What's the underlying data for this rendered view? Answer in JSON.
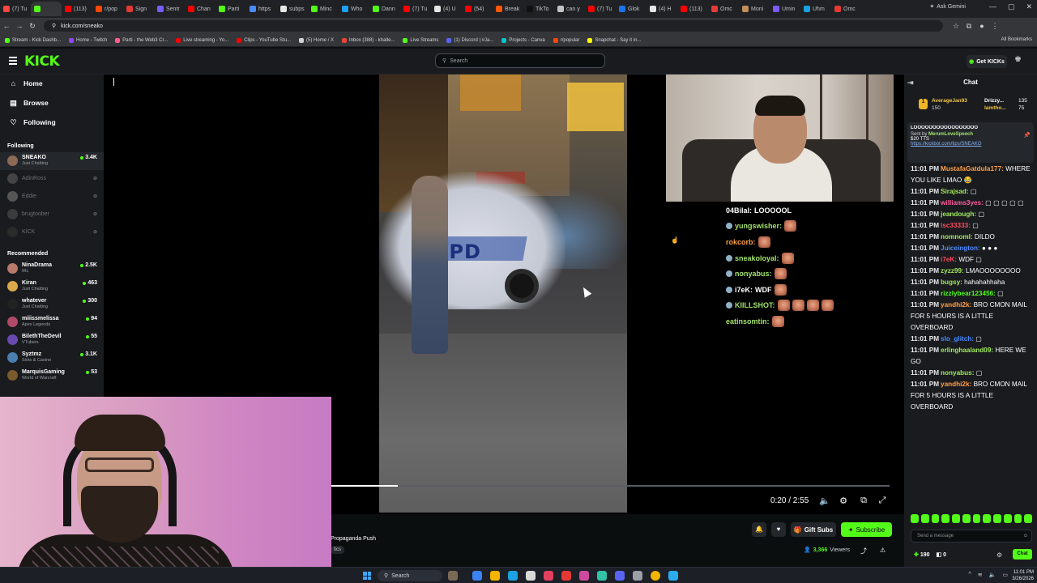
{
  "browser": {
    "tabs": [
      "(7) Tu",
      "",
      "(113)",
      "r/pop",
      "Sign",
      "Sentr",
      "Chan",
      "Parti",
      "https",
      "subps",
      "Minc",
      "Who",
      "Dann",
      "(7) Tu",
      "(4) U",
      "(54)",
      "Break",
      "TikTo",
      "can y",
      "(7) Tu",
      "Glok",
      "(4) H",
      "(113)",
      "Omc",
      "Moni",
      "Umin",
      "Uhm",
      "Omc"
    ],
    "active_tab_index": 1,
    "ask_gemini": "Ask Gemini",
    "url": "kick.com/sneako",
    "bookmarks": [
      "Stream - Kick Dashb...",
      "Home - Twitch",
      "Parti - the Web3 Cr...",
      "Live streaming - Yo...",
      "Clips - YouTube Stu...",
      "(5) Home / X",
      "Inbox (388) - khalle...",
      "Live Streams",
      "(1) Discord | #Ja...",
      "Projects - Canva",
      "r/popular",
      "Snapchat - Say it in..."
    ],
    "all_bookmarks": "All Bookmarks"
  },
  "header": {
    "logo": "KICK",
    "search_placeholder": "Search",
    "get_kicks": "Get KICKs"
  },
  "sidebar": {
    "nav": [
      {
        "label": "Home"
      },
      {
        "label": "Browse"
      },
      {
        "label": "Following"
      }
    ],
    "following_title": "Following",
    "following": [
      {
        "name": "SNEAKO",
        "category": "Just Chatting",
        "viewers": "3.4K",
        "live": true,
        "color": "#8c6a55"
      },
      {
        "name": "AdinRoss",
        "category": "",
        "viewers": "",
        "live": false,
        "color": "#444"
      },
      {
        "name": "Eddie",
        "category": "",
        "viewers": "",
        "live": false,
        "color": "#555"
      },
      {
        "name": "brugtoober",
        "category": "",
        "viewers": "",
        "live": false,
        "color": "#3b3b3b"
      },
      {
        "name": "KICK",
        "category": "",
        "viewers": "",
        "live": false,
        "color": "#2a2a2a"
      }
    ],
    "recommended_title": "Recommended",
    "recommended": [
      {
        "name": "NinaDrama",
        "category": "IRL",
        "viewers": "2.5K",
        "color": "#b87a6a"
      },
      {
        "name": "Kiran",
        "category": "Just Chatting",
        "viewers": "463",
        "color": "#d8a84a"
      },
      {
        "name": "whatever",
        "category": "Just Chatting",
        "viewers": "300",
        "color": "#222"
      },
      {
        "name": "miiissmelissa",
        "category": "Apex Legends",
        "viewers": "94",
        "color": "#b04a6a"
      },
      {
        "name": "BilethTheDevil",
        "category": "VTubers",
        "viewers": "55",
        "color": "#6a4ab0"
      },
      {
        "name": "Syztmz",
        "category": "Slots & Casino",
        "viewers": "3.1K",
        "color": "#4a80b0"
      },
      {
        "name": "MarquisGaming",
        "category": "World of Warcraft",
        "viewers": "53",
        "color": "#7a5a2a"
      }
    ]
  },
  "player": {
    "car_text": "YPD",
    "time": "0:20 / 2:55",
    "progress_fraction": 0.12
  },
  "overlay_chat": [
    {
      "user": "04Bilal:",
      "msg": "LOOOOOL",
      "user_color": "#ffffff",
      "emotes": 0,
      "badge": false
    },
    {
      "user": "yungswisher:",
      "msg": "",
      "user_color": "#a2e06b",
      "emotes": 1,
      "badge": true
    },
    {
      "user": "rokcorb:",
      "msg": "",
      "user_color": "#ff9f45",
      "emotes": 1,
      "badge": false
    },
    {
      "user": "sneakoloyal:",
      "msg": "",
      "user_color": "#a2e06b",
      "emotes": 1,
      "badge": true
    },
    {
      "user": "nonyabus:",
      "msg": "",
      "user_color": "#a2e06b",
      "emotes": 1,
      "badge": true
    },
    {
      "user": "i7eK:",
      "msg": "WDF",
      "user_color": "#ffffff",
      "emotes": 1,
      "badge": true
    },
    {
      "user": "KIILLSHOT:",
      "msg": "",
      "user_color": "#a2e06b",
      "emotes": 4,
      "badge": true
    },
    {
      "user": "eatinsomtin:",
      "msg": "",
      "user_color": "#a2e06b",
      "emotes": 1,
      "badge": false
    }
  ],
  "stream_info": {
    "title": "Propaganda Push",
    "tag": "tics",
    "gift_subs": "Gift Subs",
    "subscribe": "Subscribe",
    "viewer_count": "3,366",
    "viewers_label": "Viewers"
  },
  "chat": {
    "title": "Chat",
    "leaderboard": [
      {
        "name": "AverageJan93",
        "amount": "150"
      },
      {
        "name": "Drizzy...",
        "amount": "135"
      },
      {
        "name": "lamtho...",
        "amount": "75"
      }
    ],
    "pinned_top": "LOOOOOOOOOOOOOOOOO",
    "pinned_sender": "Sent by",
    "pinned_sender_name": "MerumLoveSpeech",
    "pinned_amount": "$20 TTS",
    "pinned_link": "https://kickbot.com/tips/SNEAKO",
    "messages": [
      {
        "time": "11:01 PM",
        "user": "MustafaGatdula177:",
        "color": "c-orange",
        "text": "WHERE YOU LIKE LMAO 😂"
      },
      {
        "time": "11:01 PM",
        "user": "Sirajsad:",
        "color": "c-lime",
        "text": "▢"
      },
      {
        "time": "11:01 PM",
        "user": "williams3yes:",
        "color": "c-pink",
        "text": "▢ ▢ ▢ ▢ ▢"
      },
      {
        "time": "11:01 PM",
        "user": "jeandough:",
        "color": "c-lime",
        "text": "▢"
      },
      {
        "time": "11:01 PM",
        "user": "lsc33333:",
        "color": "c-red",
        "text": "▢"
      },
      {
        "time": "11:01 PM",
        "user": "nomnoml:",
        "color": "c-lime",
        "text": "DILDO"
      },
      {
        "time": "11:01 PM",
        "user": "Juiceington:",
        "color": "c-blue",
        "text": "● ● ●"
      },
      {
        "time": "11:01 PM",
        "user": "i7eK:",
        "color": "c-red",
        "text": "WDF ▢"
      },
      {
        "time": "11:01 PM",
        "user": "zyzz99:",
        "color": "c-lime",
        "text": "LMAOOOOOOOO"
      },
      {
        "time": "11:01 PM",
        "user": "bugsy:",
        "color": "c-lime",
        "text": "hahahahhaha"
      },
      {
        "time": "11:01 PM",
        "user": "rizzlybear123456:",
        "color": "c-green",
        "text": "▢"
      },
      {
        "time": "11:01 PM",
        "user": "yandhi2k:",
        "color": "c-orange",
        "text": "BRO CMON MAIL FOR 5 HOURS IS A LITTLE OVERBOARD"
      },
      {
        "time": "11:01 PM",
        "user": "slo_glitch:",
        "color": "c-blue",
        "text": "▢"
      },
      {
        "time": "11:01 PM",
        "user": "erlinghaaland09:",
        "color": "c-lime",
        "text": "HERE WE GO"
      },
      {
        "time": "11:01 PM",
        "user": "nonyabus:",
        "color": "c-lime",
        "text": "▢"
      },
      {
        "time": "11:01 PM",
        "user": "yandhi2k:",
        "color": "c-orange",
        "text": "BRO CMON MAIL FOR 5 HOURS IS A LITTLE OVERBOARD"
      }
    ],
    "input_placeholder": "Send a message",
    "points": "190",
    "kicks": "0",
    "send_label": "Chat"
  },
  "taskbar": {
    "search": "Search",
    "time": "11:01 PM",
    "date": "3/26/2026"
  }
}
